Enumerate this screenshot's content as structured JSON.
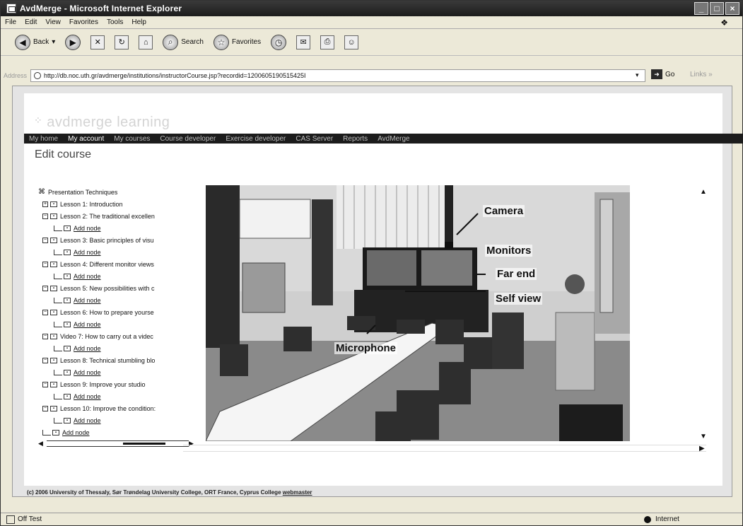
{
  "window": {
    "title": "AvdMerge - Microsoft Internet Explorer"
  },
  "menu": [
    "File",
    "Edit",
    "View",
    "Favorites",
    "Tools",
    "Help"
  ],
  "toolbar": {
    "back_label": "Back",
    "search_label": "Search",
    "favorites_label": "Favorites"
  },
  "address": {
    "label": "Address",
    "url": "http://db.noc.uth.gr/avdmerge/institutions/instructorCourse.jsp?recordid=1200605190515425I",
    "go_label": "Go",
    "links_label": "Links"
  },
  "site": {
    "logo": "avdmerge learning",
    "nav": [
      "My home",
      "My account",
      "My courses",
      "Course developer",
      "Exercise developer",
      "CAS Server",
      "Reports",
      "AvdMerge"
    ],
    "active_nav": "My account",
    "page_title": "Edit course"
  },
  "tree": {
    "root": "Presentation Techniques",
    "add_label": "Add node",
    "lessons": [
      "Lesson 1: Introduction",
      "Lesson 2: The traditional excellen",
      "Lesson 3: Basic principles of visu",
      "Lesson 4: Different monitor views",
      "Lesson 5: New possibilities with c",
      "Lesson 6: How to prepare yourse",
      "Video 7: How to carry out a videc",
      "Lesson 8: Technical stumbling blo",
      "Lesson 9: Improve your studio",
      "Lesson 10: Improve the condition:"
    ]
  },
  "photo": {
    "labels": {
      "camera": "Camera",
      "monitors": "Monitors",
      "far_end": "Far end",
      "self_view": "Self view",
      "microphone": "Microphone"
    }
  },
  "footer": {
    "text": "(c) 2006 University of Thessaly, Sør Trøndelag University College, ORT France, Cyprus College",
    "webmaster": "webmaster"
  },
  "status": {
    "text": "Off Test",
    "zone": "Internet"
  }
}
